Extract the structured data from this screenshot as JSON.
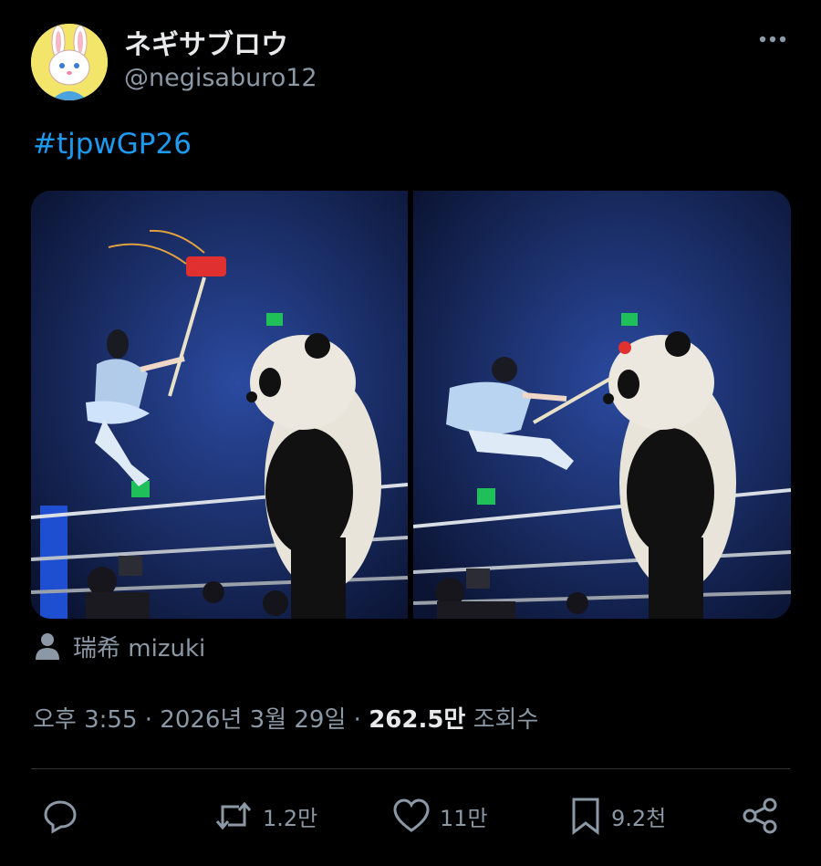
{
  "author": {
    "name": "ネギサブロウ",
    "handle": "@negisaburo12",
    "avatar_icon": "rabbit-avatar-icon"
  },
  "post": {
    "hashtag": "#tjpwGP26",
    "media": [
      {
        "alt": "wrestler leaping at panda with mallet"
      },
      {
        "alt": "wrestler striking panda with mallet"
      }
    ],
    "tagged_user": "瑞希 mizuki",
    "time": "오후 3:55",
    "date": "2026년 3월 29일",
    "views_count": "262.5만",
    "views_label": "조회수",
    "separator": "·"
  },
  "actions": {
    "reply": {
      "icon": "reply-icon",
      "count": ""
    },
    "retweet": {
      "icon": "retweet-icon",
      "count": "1.2만"
    },
    "like": {
      "icon": "heart-icon",
      "count": "11만"
    },
    "bookmark": {
      "icon": "bookmark-icon",
      "count": "9.2천"
    },
    "share": {
      "icon": "share-icon"
    }
  },
  "colors": {
    "background": "#000000",
    "text": "#e7e9ea",
    "muted": "#8b98a5",
    "link": "#1d9bf0"
  }
}
